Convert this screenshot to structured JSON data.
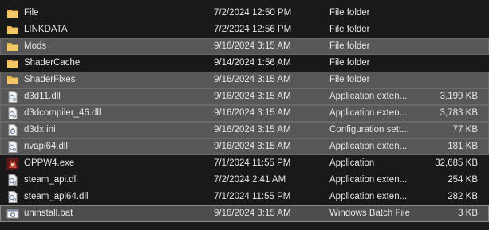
{
  "files": [
    {
      "name": "File",
      "date": "7/2/2024 12:50 PM",
      "type": "File folder",
      "size": "",
      "icon": "folder-icon",
      "state": ""
    },
    {
      "name": "LINKDATA",
      "date": "7/2/2024 12:56 PM",
      "type": "File folder",
      "size": "",
      "icon": "folder-icon",
      "state": ""
    },
    {
      "name": "Mods",
      "date": "9/16/2024 3:15 AM",
      "type": "File folder",
      "size": "",
      "icon": "folder-icon",
      "state": "selected"
    },
    {
      "name": "ShaderCache",
      "date": "9/14/2024 1:56 AM",
      "type": "File folder",
      "size": "",
      "icon": "folder-icon",
      "state": ""
    },
    {
      "name": "ShaderFixes",
      "date": "9/16/2024 3:15 AM",
      "type": "File folder",
      "size": "",
      "icon": "folder-icon",
      "state": "selected"
    },
    {
      "name": "d3d11.dll",
      "date": "9/16/2024 3:15 AM",
      "type": "Application exten...",
      "size": "3,199 KB",
      "icon": "dll-file-icon",
      "state": "selected"
    },
    {
      "name": "d3dcompiler_46.dll",
      "date": "9/16/2024 3:15 AM",
      "type": "Application exten...",
      "size": "3,783 KB",
      "icon": "dll-file-icon",
      "state": "selected"
    },
    {
      "name": "d3dx.ini",
      "date": "9/16/2024 3:15 AM",
      "type": "Configuration sett...",
      "size": "77 KB",
      "icon": "ini-file-icon",
      "state": "selected"
    },
    {
      "name": "nvapi64.dll",
      "date": "9/16/2024 3:15 AM",
      "type": "Application exten...",
      "size": "181 KB",
      "icon": "dll-file-icon",
      "state": "selected"
    },
    {
      "name": "OPPW4.exe",
      "date": "7/1/2024 11:55 PM",
      "type": "Application",
      "size": "32,685 KB",
      "icon": "exe-game-icon",
      "state": ""
    },
    {
      "name": "steam_api.dll",
      "date": "7/2/2024 2:41 AM",
      "type": "Application exten...",
      "size": "254 KB",
      "icon": "dll-file-icon",
      "state": ""
    },
    {
      "name": "steam_api64.dll",
      "date": "7/1/2024 11:55 PM",
      "type": "Application exten...",
      "size": "282 KB",
      "icon": "dll-file-icon",
      "state": ""
    },
    {
      "name": "uninstall.bat",
      "date": "9/16/2024 3:15 AM",
      "type": "Windows Batch File",
      "size": "3 KB",
      "icon": "bat-file-icon",
      "state": "focus"
    }
  ],
  "colors": {
    "background": "#191919",
    "selected": "#575757",
    "folder": "#e8b64a",
    "text": "#e6e6e6"
  }
}
